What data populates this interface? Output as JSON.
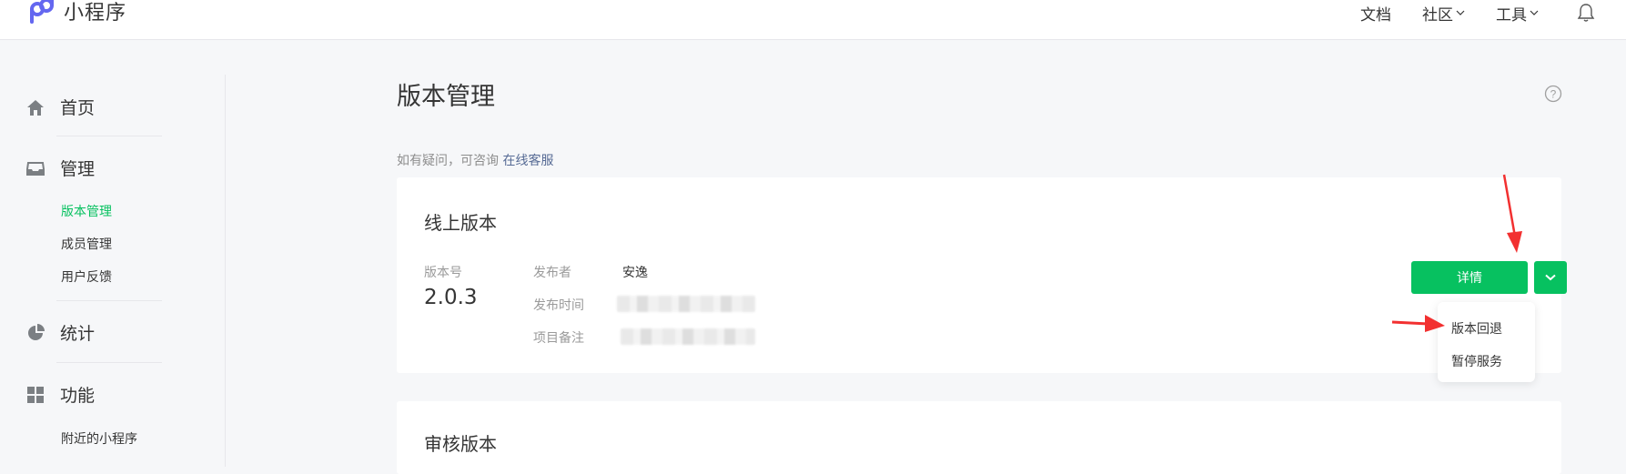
{
  "header": {
    "app_name": "小程序",
    "nav": [
      {
        "label": "文档"
      },
      {
        "label": "社区"
      },
      {
        "label": "工具"
      }
    ]
  },
  "sidebar": {
    "groups": [
      {
        "label": "首页",
        "icon": "home-icon"
      },
      {
        "label": "管理",
        "icon": "inbox-icon",
        "items": [
          "版本管理",
          "成员管理",
          "用户反馈"
        ],
        "active": "版本管理"
      },
      {
        "label": "统计",
        "icon": "pie-chart-icon"
      },
      {
        "label": "功能",
        "icon": "grid-icon",
        "items": [
          "附近的小程序"
        ]
      }
    ]
  },
  "main": {
    "title": "版本管理",
    "hint_prefix": "如有疑问，可咨询",
    "hint_link": "在线客服",
    "online_card": {
      "title": "线上版本",
      "version_label": "版本号",
      "version_value": "2.0.3",
      "publisher_label": "发布者",
      "publisher_value": "安逸",
      "publish_time_label": "发布时间",
      "note_label": "项目备注",
      "detail_button": "详情",
      "dropdown": [
        "版本回退",
        "暂停服务"
      ]
    },
    "review_card": {
      "title": "审核版本"
    }
  },
  "colors": {
    "accent": "#07c160",
    "link": "#576b95",
    "annotation": "#f23030"
  }
}
